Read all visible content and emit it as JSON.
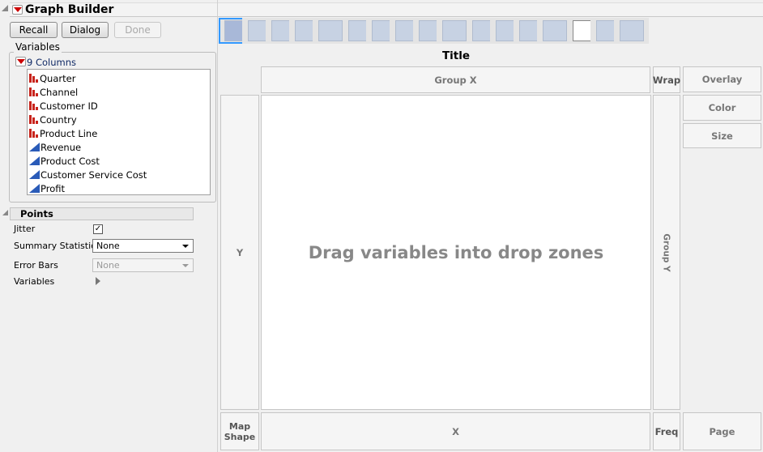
{
  "header": {
    "title": "Graph Builder"
  },
  "buttons": {
    "recall": "Recall",
    "dialog": "Dialog",
    "done": "Done"
  },
  "variables": {
    "label": "Variables",
    "columns_label": "9 Columns",
    "items": [
      {
        "name": "Quarter",
        "type": "nominal"
      },
      {
        "name": "Channel",
        "type": "nominal"
      },
      {
        "name": "Customer ID",
        "type": "nominal"
      },
      {
        "name": "Country",
        "type": "nominal"
      },
      {
        "name": "Product Line",
        "type": "nominal"
      },
      {
        "name": "Revenue",
        "type": "continuous"
      },
      {
        "name": "Product Cost",
        "type": "continuous"
      },
      {
        "name": "Customer Service Cost",
        "type": "continuous"
      },
      {
        "name": "Profit",
        "type": "continuous"
      }
    ]
  },
  "points": {
    "title": "Points",
    "jitter_label": "Jitter",
    "jitter_checked": true,
    "summary_label": "Summary Statistic",
    "summary_value": "None",
    "error_label": "Error Bars",
    "error_value": "None",
    "variables_label": "Variables"
  },
  "toolbar": [
    "points",
    "smoother",
    "line-of-fit",
    "ellipse",
    "contour",
    "line",
    "bar",
    "area",
    "box-plot",
    "histogram",
    "heatmap",
    "pie",
    "treemap",
    "mosaic",
    "caption-box",
    "formula",
    "map-shapes"
  ],
  "graph": {
    "title": "Title",
    "placeholder": "Drag variables into drop zones"
  },
  "zones": {
    "group_x": "Group X",
    "wrap": "Wrap",
    "overlay": "Overlay",
    "color": "Color",
    "size": "Size",
    "y": "Y",
    "group_y": "Group Y",
    "map_shape": "Map Shape",
    "x": "X",
    "freq": "Freq",
    "page": "Page"
  }
}
